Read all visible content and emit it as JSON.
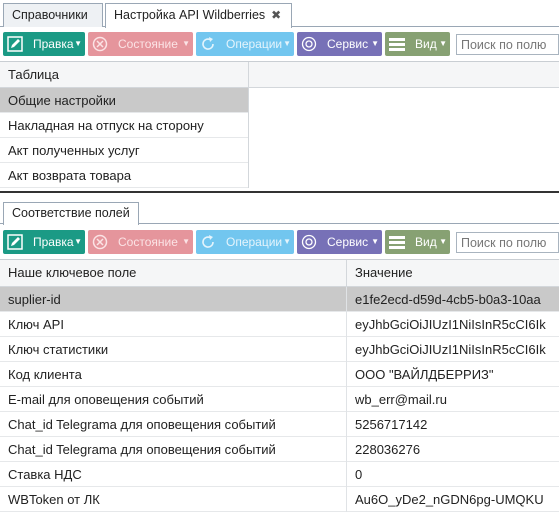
{
  "tabs": [
    {
      "label": "Справочники"
    },
    {
      "label": "Настройка API Wildberries"
    }
  ],
  "toolbar": {
    "edit_label": "Правка",
    "state_label": "Состояние",
    "ops_label": "Операции",
    "service_label": "Сервис",
    "view_label": "Вид",
    "search_placeholder": "Поиск по полю"
  },
  "upper_table": {
    "header": "Таблица",
    "rows": [
      "Общие настройки",
      "Накладная на отпуск на сторону",
      "Акт полученных услуг",
      "Акт возврата товара"
    ]
  },
  "subtab": {
    "label": "Соответствие полей"
  },
  "lower_table": {
    "headers": [
      "Наше ключевое поле",
      "Значение"
    ],
    "rows": [
      {
        "key": "suplier-id",
        "value": "e1fe2ecd-d59d-4cb5-b0a3-10aa"
      },
      {
        "key": "Ключ API",
        "value": "eyJhbGciOiJIUzI1NiIsInR5cCI6Ik"
      },
      {
        "key": "Ключ статистики",
        "value": "eyJhbGciOiJIUzI1NiIsInR5cCI6Ik"
      },
      {
        "key": "Код клиента",
        "value": "ООО \"ВАЙЛДБЕРРИЗ\""
      },
      {
        "key": "E-mail для оповещения событий",
        "value": "wb_err@mail.ru"
      },
      {
        "key": "Chat_id Telegrama для оповещения событий",
        "value": "5256717142"
      },
      {
        "key": "Chat_id Telegrama для оповещения событий",
        "value": "228036276"
      },
      {
        "key": "Ставка НДС",
        "value": "0"
      },
      {
        "key": "WBToken от ЛК",
        "value": "Au6O_yDe2_nGDN6pg-UMQKU"
      }
    ]
  },
  "colors": {
    "edit": "#1b9a85",
    "state": "#e5959c",
    "ops": "#72c6ef",
    "service": "#7771b7",
    "view": "#87a173",
    "selected_row": "#c9c9c9"
  }
}
